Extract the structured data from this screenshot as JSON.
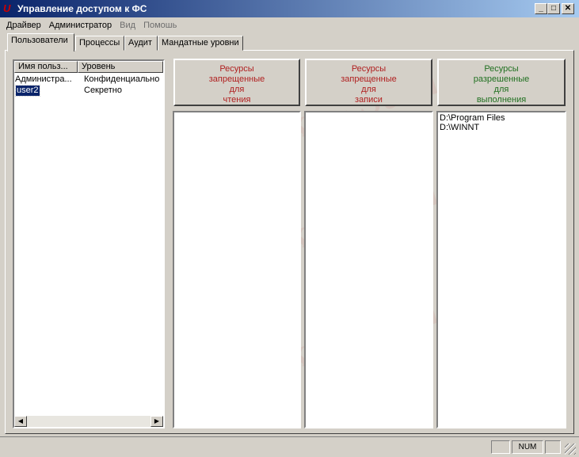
{
  "window": {
    "title": "Управление доступом к ФС",
    "icon": "U",
    "minimize": "_",
    "maximize": "□",
    "close": "✕"
  },
  "menu": [
    {
      "label": "Драйвер"
    },
    {
      "label": "Администратор"
    },
    {
      "label": "Вид"
    },
    {
      "label": "Помошь"
    }
  ],
  "tabs": [
    {
      "label": "Пользователи"
    },
    {
      "label": "Процессы"
    },
    {
      "label": "Аудит"
    },
    {
      "label": "Мандатные уровни"
    }
  ],
  "users": {
    "columns": [
      "Имя польз...",
      "Уровень"
    ],
    "rows": [
      {
        "name": "Администра...",
        "level": "Конфиденциально"
      },
      {
        "name": "user2",
        "level": "Секретно",
        "selected": true
      }
    ]
  },
  "resources": [
    {
      "label": [
        "Ресурсы",
        "запрещенные",
        "для",
        "чтения"
      ],
      "color": "#b02020",
      "items": []
    },
    {
      "label": [
        "Ресурсы",
        "запрещенные",
        "для",
        "записи"
      ],
      "color": "#b02020",
      "items": []
    },
    {
      "label": [
        "Ресурсы",
        "разрешенные",
        "для",
        "выполнения"
      ],
      "color": "#207020",
      "items": [
        "D:\\Program Files",
        "D:\\WINNT"
      ]
    }
  ],
  "statusbar": {
    "num": "NUM"
  },
  "watermark": "Stud.kz"
}
